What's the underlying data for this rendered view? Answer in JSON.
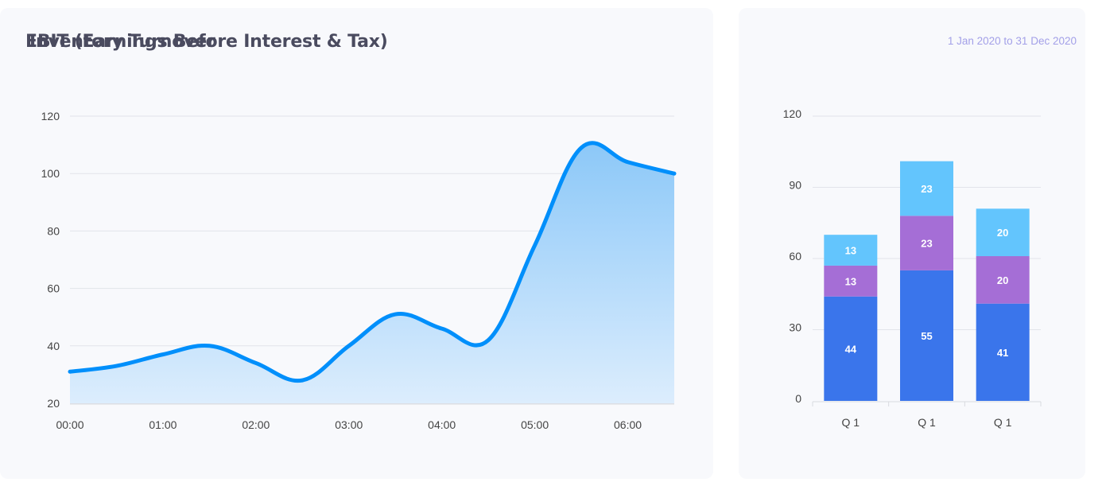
{
  "ebit_card": {
    "title": "EBIT (Earnings Before Interest & Tax)",
    "date_range": "1 Jan 2020 to 31 Dec 2020"
  },
  "inventory_card": {
    "title": "Inventory Turnover"
  },
  "chart_data": [
    {
      "type": "area",
      "title": "EBIT (Earnings Before Interest & Tax)",
      "x_tick_labels": [
        "00:00",
        "01:00",
        "02:00",
        "03:00",
        "04:00",
        "05:00",
        "06:00"
      ],
      "x_hours": [
        0,
        0.5,
        1,
        1.5,
        2,
        2.5,
        3,
        3.5,
        4,
        4.5,
        5,
        5.5,
        6,
        6.5
      ],
      "values": [
        31,
        33,
        37,
        40,
        34,
        28,
        40,
        51,
        46,
        42,
        75,
        109,
        104,
        100
      ],
      "ylim": [
        20,
        120
      ],
      "y_ticks": [
        20,
        40,
        60,
        80,
        100,
        120
      ],
      "grid": true,
      "line_color": "#008ffb",
      "fill_color_top": "#8cc8f8",
      "fill_color_bottom": "#dcedfd"
    },
    {
      "type": "bar",
      "stacked": true,
      "title": "Inventory Turnover",
      "categories": [
        "Q 1",
        "Q 1",
        "Q 1"
      ],
      "series": [
        {
          "values": [
            44,
            55,
            41
          ],
          "color": "#3a75eb"
        },
        {
          "values": [
            13,
            23,
            20
          ],
          "color": "#a56ed6"
        },
        {
          "values": [
            13,
            23,
            20
          ],
          "color": "#63c5fd"
        }
      ],
      "ylim": [
        0,
        120
      ],
      "y_ticks": [
        0,
        30,
        60,
        90,
        120
      ],
      "grid": true
    }
  ]
}
